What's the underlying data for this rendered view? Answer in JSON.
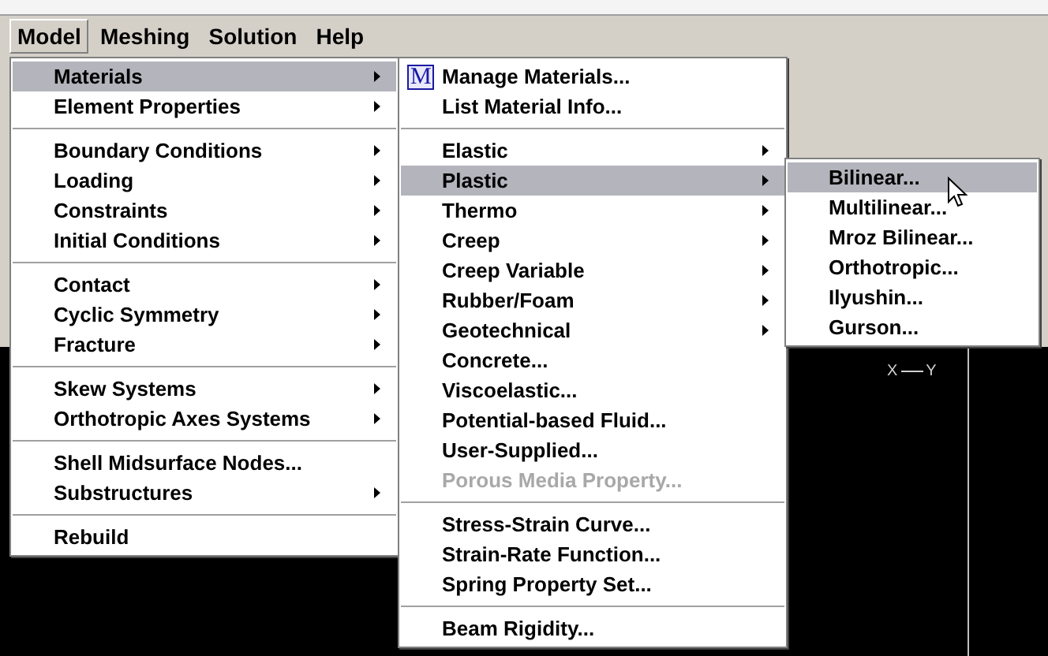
{
  "menubar": [
    {
      "label": "Model",
      "selected": true
    },
    {
      "label": "Meshing",
      "selected": false
    },
    {
      "label": "Solution",
      "selected": false
    },
    {
      "label": "Help",
      "selected": false
    }
  ],
  "menus": [
    {
      "items": [
        {
          "kind": "item",
          "label": "Materials",
          "submenu": true,
          "selected": true,
          "disabled": false
        },
        {
          "kind": "item",
          "label": "Element Properties",
          "submenu": true,
          "selected": false,
          "disabled": false
        },
        {
          "kind": "separator"
        },
        {
          "kind": "item",
          "label": "Boundary Conditions",
          "submenu": true,
          "selected": false,
          "disabled": false
        },
        {
          "kind": "item",
          "label": "Loading",
          "submenu": true,
          "selected": false,
          "disabled": false
        },
        {
          "kind": "item",
          "label": "Constraints",
          "submenu": true,
          "selected": false,
          "disabled": false
        },
        {
          "kind": "item",
          "label": "Initial Conditions",
          "submenu": true,
          "selected": false,
          "disabled": false
        },
        {
          "kind": "separator"
        },
        {
          "kind": "item",
          "label": "Contact",
          "submenu": true,
          "selected": false,
          "disabled": false
        },
        {
          "kind": "item",
          "label": "Cyclic Symmetry",
          "submenu": true,
          "selected": false,
          "disabled": false
        },
        {
          "kind": "item",
          "label": "Fracture",
          "submenu": true,
          "selected": false,
          "disabled": false
        },
        {
          "kind": "separator"
        },
        {
          "kind": "item",
          "label": "Skew Systems",
          "submenu": true,
          "selected": false,
          "disabled": false
        },
        {
          "kind": "item",
          "label": "Orthotropic Axes Systems",
          "submenu": true,
          "selected": false,
          "disabled": false
        },
        {
          "kind": "separator"
        },
        {
          "kind": "item",
          "label": "Shell Midsurface Nodes...",
          "submenu": false,
          "selected": false,
          "disabled": false
        },
        {
          "kind": "item",
          "label": "Substructures",
          "submenu": true,
          "selected": false,
          "disabled": false
        },
        {
          "kind": "separator"
        },
        {
          "kind": "item",
          "label": "Rebuild",
          "submenu": false,
          "selected": false,
          "disabled": false
        }
      ]
    },
    {
      "items": [
        {
          "kind": "item",
          "label": "Manage Materials...",
          "icon_glyph": "M",
          "submenu": false,
          "selected": false,
          "disabled": false
        },
        {
          "kind": "item",
          "label": "List Material Info...",
          "submenu": false,
          "selected": false,
          "disabled": false
        },
        {
          "kind": "separator"
        },
        {
          "kind": "item",
          "label": "Elastic",
          "submenu": true,
          "selected": false,
          "disabled": false
        },
        {
          "kind": "item",
          "label": "Plastic",
          "submenu": true,
          "selected": true,
          "disabled": false
        },
        {
          "kind": "item",
          "label": "Thermo",
          "submenu": true,
          "selected": false,
          "disabled": false
        },
        {
          "kind": "item",
          "label": "Creep",
          "submenu": true,
          "selected": false,
          "disabled": false
        },
        {
          "kind": "item",
          "label": "Creep Variable",
          "submenu": true,
          "selected": false,
          "disabled": false
        },
        {
          "kind": "item",
          "label": "Rubber/Foam",
          "submenu": true,
          "selected": false,
          "disabled": false
        },
        {
          "kind": "item",
          "label": "Geotechnical",
          "submenu": true,
          "selected": false,
          "disabled": false
        },
        {
          "kind": "item",
          "label": "Concrete...",
          "submenu": false,
          "selected": false,
          "disabled": false
        },
        {
          "kind": "item",
          "label": "Viscoelastic...",
          "submenu": false,
          "selected": false,
          "disabled": false
        },
        {
          "kind": "item",
          "label": "Potential-based Fluid...",
          "submenu": false,
          "selected": false,
          "disabled": false
        },
        {
          "kind": "item",
          "label": "User-Supplied...",
          "submenu": false,
          "selected": false,
          "disabled": false
        },
        {
          "kind": "item",
          "label": "Porous Media Property...",
          "submenu": false,
          "selected": false,
          "disabled": true
        },
        {
          "kind": "separator"
        },
        {
          "kind": "item",
          "label": "Stress-Strain Curve...",
          "submenu": false,
          "selected": false,
          "disabled": false
        },
        {
          "kind": "item",
          "label": "Strain-Rate Function...",
          "submenu": false,
          "selected": false,
          "disabled": false
        },
        {
          "kind": "item",
          "label": "Spring Property Set...",
          "submenu": false,
          "selected": false,
          "disabled": false
        },
        {
          "kind": "separator"
        },
        {
          "kind": "item",
          "label": "Beam Rigidity...",
          "submenu": false,
          "selected": false,
          "disabled": false
        }
      ]
    },
    {
      "items": [
        {
          "kind": "item",
          "label": "Bilinear...",
          "submenu": false,
          "selected": true,
          "disabled": false
        },
        {
          "kind": "item",
          "label": "Multilinear...",
          "submenu": false,
          "selected": false,
          "disabled": false
        },
        {
          "kind": "item",
          "label": "Mroz Bilinear...",
          "submenu": false,
          "selected": false,
          "disabled": false
        },
        {
          "kind": "item",
          "label": "Orthotropic...",
          "submenu": false,
          "selected": false,
          "disabled": false
        },
        {
          "kind": "item",
          "label": "Ilyushin...",
          "submenu": false,
          "selected": false,
          "disabled": false
        },
        {
          "kind": "item",
          "label": "Gurson...",
          "submenu": false,
          "selected": false,
          "disabled": false
        }
      ]
    }
  ],
  "axis_labels": [
    "X",
    "Y"
  ]
}
